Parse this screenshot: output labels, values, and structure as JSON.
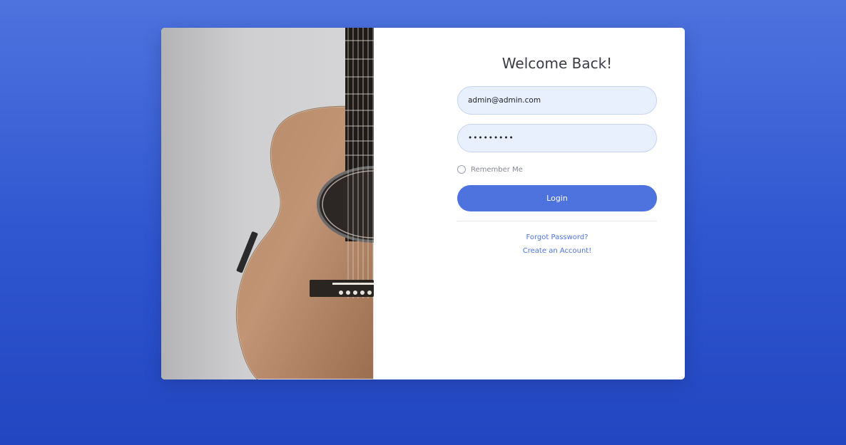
{
  "login": {
    "title": "Welcome Back!",
    "email_value": "admin@admin.com",
    "password_value": "•••••••••",
    "remember_label": "Remember Me",
    "login_label": "Login",
    "forgot_label": "Forgot Password?",
    "create_label": "Create an Account!"
  },
  "image": {
    "subject": "acoustic-guitar-photo"
  },
  "colors": {
    "background_top": "#4e73df",
    "background_bottom": "#2246c1",
    "primary": "#4e73df",
    "input_fill": "#e8f0fe",
    "title_text": "#3a3b45",
    "muted_text": "#858796"
  }
}
